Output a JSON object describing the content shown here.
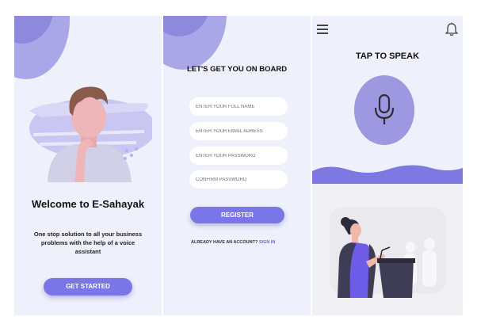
{
  "welcome": {
    "title": "Welcome to E-Sahayak",
    "subtitle": "One stop solution to all your business problems with the help of a voice assistant",
    "cta_label": "GET STARTED"
  },
  "register": {
    "title": "LET'S GET YOU ON BOARD",
    "fields": {
      "full_name_placeholder": "ENTER YOUR FULL NAME",
      "email_placeholder": "ENTER YOUR EMAIL ADRESS",
      "password_placeholder": "ENTER YOUR PASSWORD",
      "confirm_placeholder": "CONFIRM PASSWORD"
    },
    "register_label": "REGISTER",
    "have_account_text": "ALREADY HAVE AN ACCOUNT? ",
    "signin_label": "SIGN IN"
  },
  "speak": {
    "title": "TAP TO SPEAK",
    "menu_icon": "hamburger-menu-icon",
    "bell_icon": "notification-bell-icon",
    "mic_icon": "microphone-icon"
  },
  "colors": {
    "screen_bg": "#eef0fb",
    "accent": "#7a76e8",
    "blob_light": "#aaa7e8",
    "blob_dark": "#8e89dd",
    "mic_circle": "#9d98df"
  }
}
